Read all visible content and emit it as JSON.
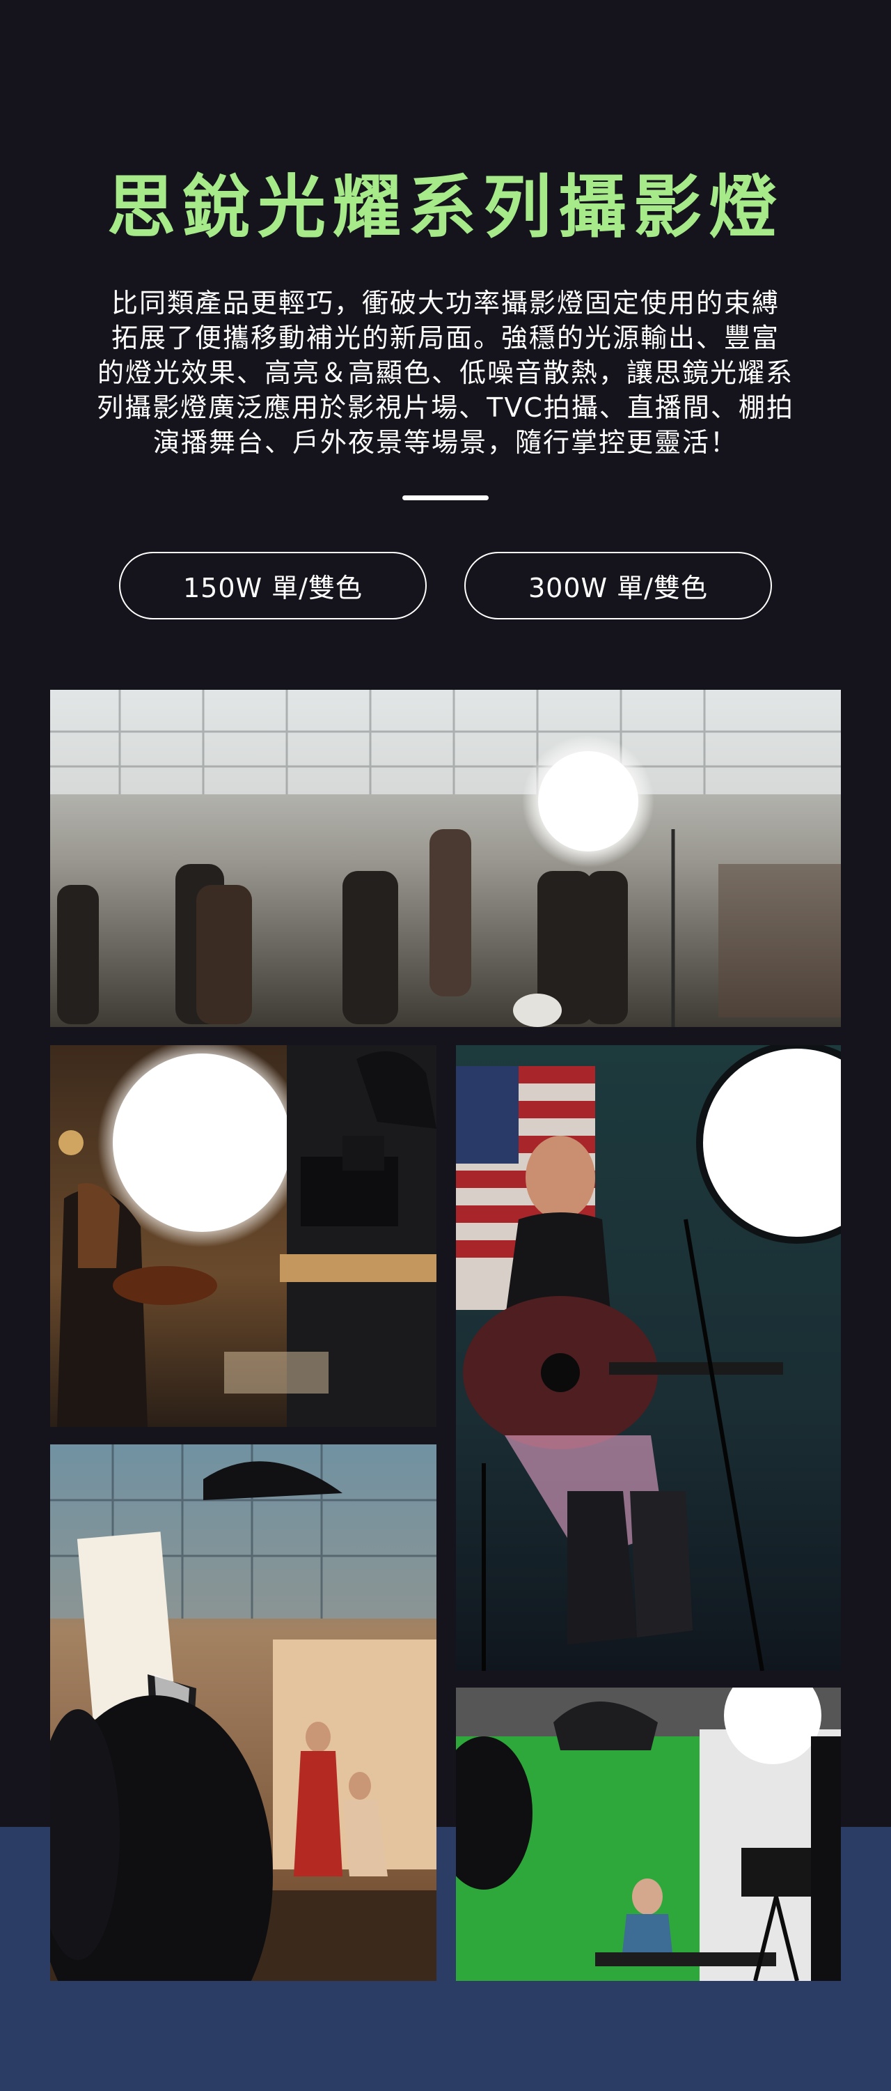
{
  "header": {
    "title": "思銳光耀系列攝影燈",
    "description_lines": [
      "比同類產品更輕巧，衝破大功率攝影燈固定使用的束縛",
      "拓展了便攜移動補光的新局面。強穩的光源輸出、豐富",
      "的燈光效果、高亮＆高顯色、低噪音散熱，讓思鏡光耀系",
      "列攝影燈廣泛應用於影視片場、TVC拍攝、直播間、棚拍",
      "演播舞台、戶外夜景等場景，隨行掌控更靈活！"
    ]
  },
  "options": [
    {
      "label": "150W 單/雙色"
    },
    {
      "label": "300W 單/雙色"
    }
  ],
  "photos": [
    {
      "name": "film-set-warehouse-photo"
    },
    {
      "name": "violin-video-shoot-photo"
    },
    {
      "name": "guitar-singer-stage-photo"
    },
    {
      "name": "studio-fashion-shoot-photo"
    },
    {
      "name": "green-screen-studio-photo"
    }
  ],
  "colors": {
    "background": "#15141c",
    "title": "#a6ea8a",
    "bottom_band": "#2b3d65",
    "text": "#ffffff"
  }
}
